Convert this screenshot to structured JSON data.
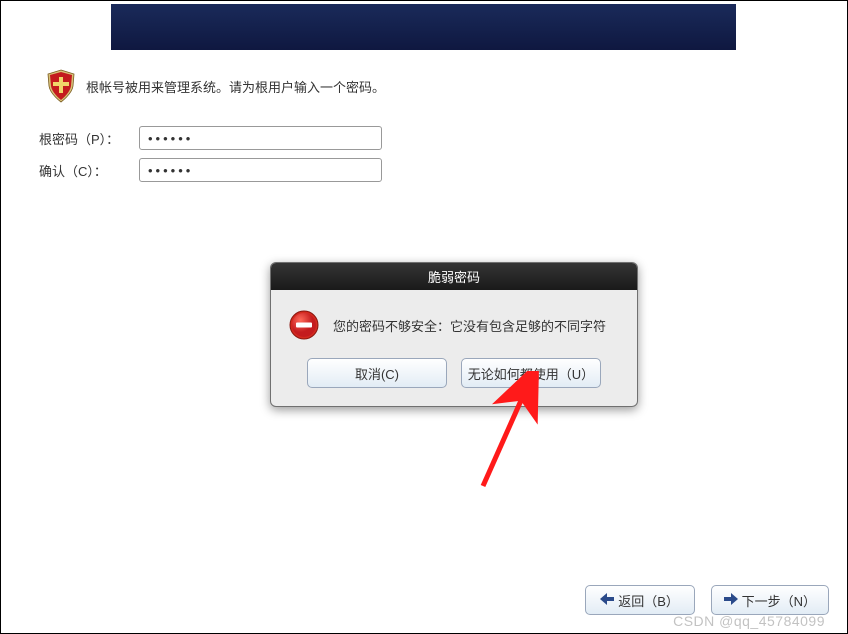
{
  "intro": {
    "text": "根帐号被用来管理系统。请为根用户输入一个密码。"
  },
  "form": {
    "root_password_label": "根密码（P）：",
    "root_password_value": "••••••",
    "confirm_label": "确认（C）：",
    "confirm_value": "••••••"
  },
  "dialog": {
    "title": "脆弱密码",
    "message": "您的密码不够安全：它没有包含足够的不同字符",
    "cancel_label": "取消(C)",
    "use_anyway_label": "无论如何都使用（U）"
  },
  "footer": {
    "back_label": "返回（B）",
    "next_label": "下一步（N）"
  },
  "watermark": "CSDN @qq_45784099"
}
